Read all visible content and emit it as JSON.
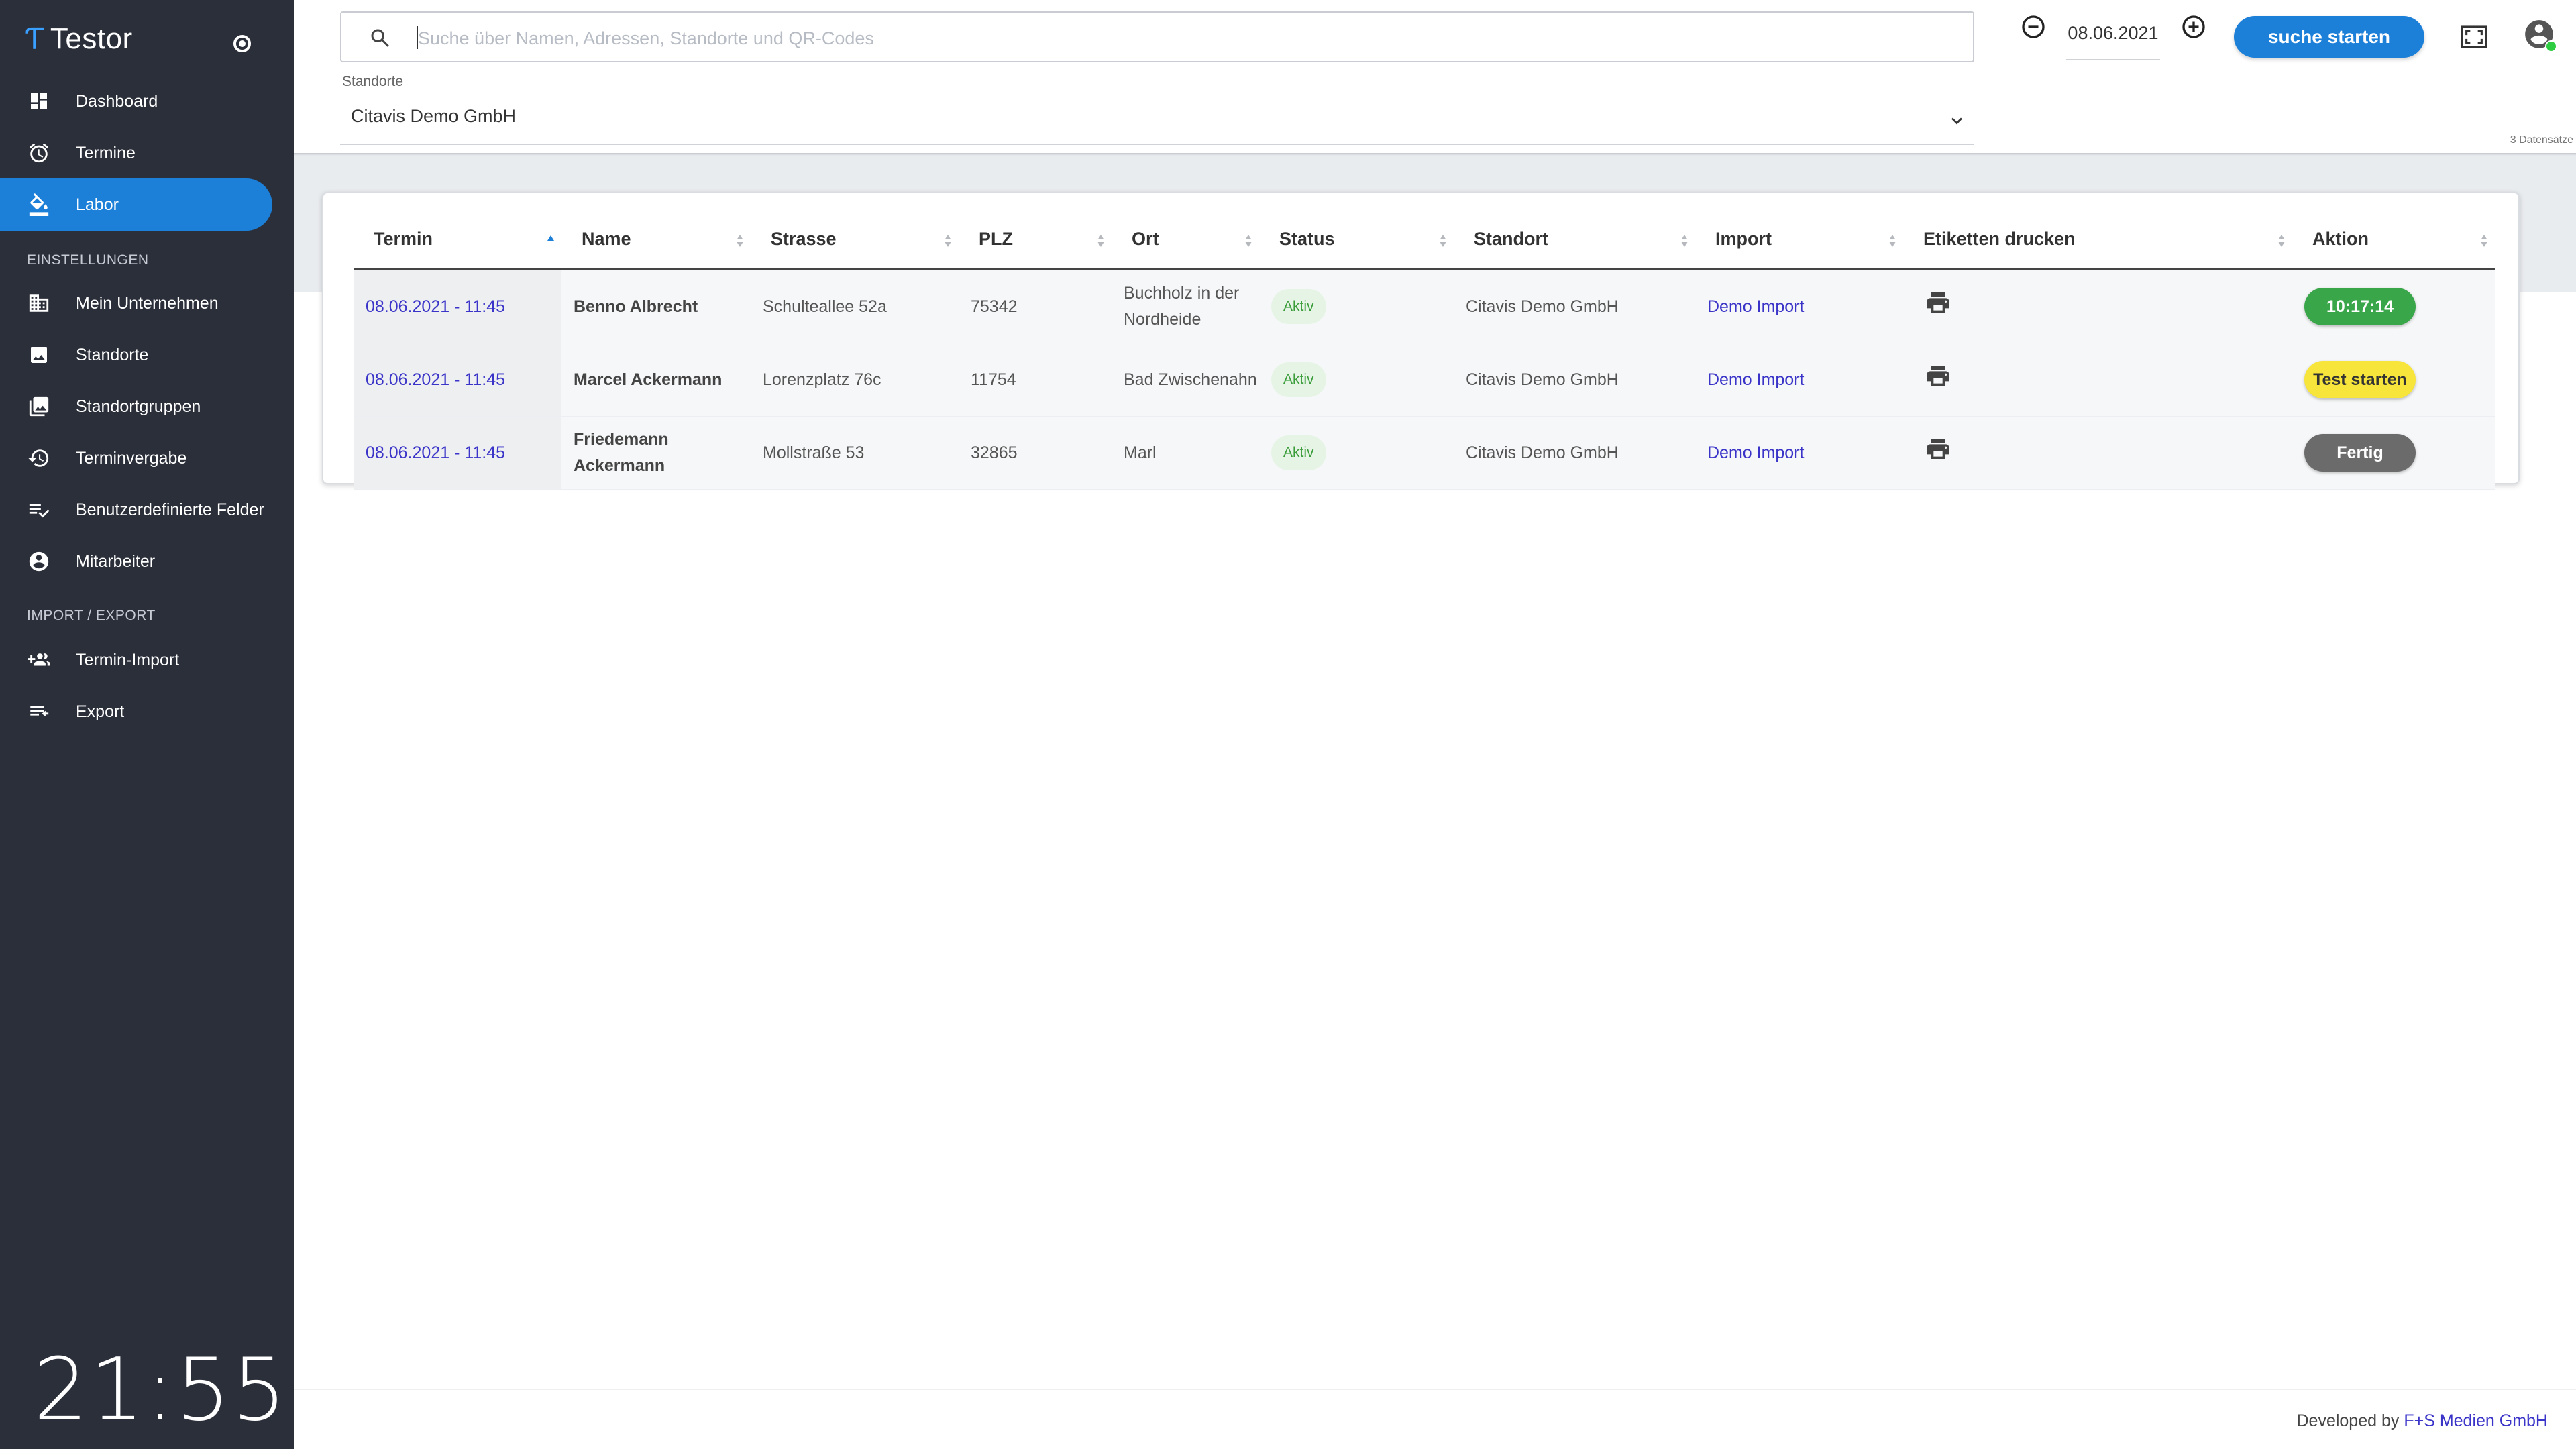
{
  "app": {
    "name": "Testor"
  },
  "sidebar": {
    "nav_main": [
      {
        "label": "Dashboard",
        "icon": "dashboard-icon"
      },
      {
        "label": "Termine",
        "icon": "alarm-clock-icon"
      },
      {
        "label": "Labor",
        "icon": "lab-icon",
        "active": true
      }
    ],
    "section_settings": "EINSTELLUNGEN",
    "nav_settings": [
      {
        "label": "Mein Unternehmen",
        "icon": "building-icon"
      },
      {
        "label": "Standorte",
        "icon": "image-icon"
      },
      {
        "label": "Standortgruppen",
        "icon": "image-group-icon"
      },
      {
        "label": "Terminvergabe",
        "icon": "history-icon"
      },
      {
        "label": "Benutzerdefinierte Felder",
        "icon": "playlist-check-icon"
      },
      {
        "label": "Mitarbeiter",
        "icon": "account-circle-icon"
      }
    ],
    "section_import": "IMPORT / EXPORT",
    "nav_import": [
      {
        "label": "Termin-Import",
        "icon": "group-add-icon"
      },
      {
        "label": "Export",
        "icon": "export-list-icon"
      }
    ],
    "clock": "21:55"
  },
  "header": {
    "search_placeholder": "Suche über Namen, Adressen, Standorte und QR-Codes",
    "date": "08.06.2021",
    "search_button": "suche starten",
    "standorte_label": "Standorte",
    "standorte_value": "Citavis Demo GmbH",
    "record_count": "3 Datensätze"
  },
  "colors": {
    "primary": "#1c7fd8",
    "sidebar": "#2b2f3a",
    "link": "#3a34c8",
    "green": "#3aa64a",
    "yellow": "#f7e53b",
    "gray": "#6b6b6b"
  },
  "table": {
    "columns": [
      "Termin",
      "Name",
      "Strasse",
      "PLZ",
      "Ort",
      "Status",
      "Standort",
      "Import",
      "Etiketten drucken",
      "Aktion"
    ],
    "rows": [
      {
        "termin": "08.06.2021 - 11:45",
        "name": "Benno Albrecht",
        "strasse": "Schulteallee 52a",
        "plz": "75342",
        "ort": "Buchholz in der Nordheide",
        "status": "Aktiv",
        "standort": "Citavis Demo GmbH",
        "import": "Demo Import",
        "aktion": "10:17:14",
        "aktion_style": "green"
      },
      {
        "termin": "08.06.2021 - 11:45",
        "name": "Marcel Ackermann",
        "strasse": "Lorenzplatz 76c",
        "plz": "11754",
        "ort": "Bad Zwischenahn",
        "status": "Aktiv",
        "standort": "Citavis Demo GmbH",
        "import": "Demo Import",
        "aktion": "Test starten",
        "aktion_style": "yellow"
      },
      {
        "termin": "08.06.2021 - 11:45",
        "name": "Friedemann Ackermann",
        "strasse": "Mollstraße 53",
        "plz": "32865",
        "ort": "Marl",
        "status": "Aktiv",
        "standort": "Citavis Demo GmbH",
        "import": "Demo Import",
        "aktion": "Fertig",
        "aktion_style": "gray"
      }
    ]
  },
  "footer": {
    "text": "Developed by",
    "link": "F+S Medien GmbH"
  }
}
